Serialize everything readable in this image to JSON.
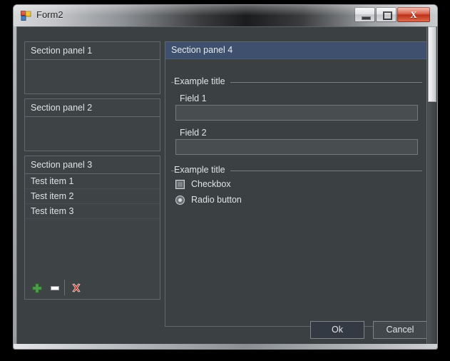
{
  "window": {
    "title": "Form2",
    "icon": "form-designer-icon",
    "controls": {
      "minimize": "minimize-icon",
      "maximize": "maximize-icon",
      "close": "X"
    }
  },
  "left_column": {
    "panels": [
      {
        "title": "Section panel 1",
        "items": []
      },
      {
        "title": "Section panel 2",
        "items": []
      },
      {
        "title": "Section panel 3",
        "items": [
          "Test item 1",
          "Test item 2",
          "Test item 3"
        ],
        "toolbar": [
          {
            "name": "add-icon",
            "tooltip": "Add"
          },
          {
            "name": "remove-icon",
            "tooltip": "Remove"
          },
          {
            "name": "delete-icon",
            "tooltip": "Delete"
          }
        ]
      }
    ]
  },
  "right_panel": {
    "title": "Section panel 4",
    "groups": [
      {
        "label": "Example title"
      },
      {
        "label": "Example title"
      }
    ],
    "fields": [
      {
        "label": "Field 1",
        "value": "",
        "placeholder": ""
      },
      {
        "label": "Field 2",
        "value": "",
        "placeholder": ""
      }
    ],
    "checkbox": {
      "label": "Checkbox",
      "checked": false
    },
    "radio": {
      "label": "Radio button",
      "checked": true
    }
  },
  "footer": {
    "ok_label": "Ok",
    "cancel_label": "Cancel"
  },
  "colors": {
    "form_background": "#3b4043",
    "panel_background": "#3e4346",
    "panel_border": "#62676b",
    "active_header": "#3e506e",
    "text": "#dfe3e6",
    "input_background": "#484d50",
    "add_icon": "#3d8b3d",
    "delete_icon": "#c0392b",
    "close_button": "#bc2f16"
  }
}
